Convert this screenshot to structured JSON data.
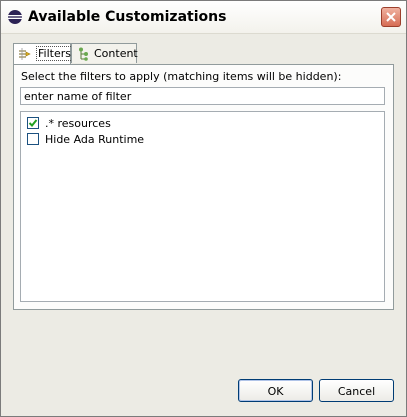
{
  "window": {
    "title": "Available Customizations"
  },
  "tabs": [
    {
      "label": "Filters",
      "icon": "filter-icon"
    },
    {
      "label": "Content",
      "icon": "content-tree-icon"
    }
  ],
  "filters": {
    "instruction": "Select the filters to apply (matching items will be hidden):",
    "input_value": "enter name of filter",
    "items": [
      {
        "label": ".* resources",
        "checked": true
      },
      {
        "label": "Hide Ada Runtime",
        "checked": false
      }
    ]
  },
  "buttons": {
    "ok": "OK",
    "cancel": "Cancel"
  },
  "colors": {
    "check": "#21a121",
    "close_button": "#d66d55",
    "accent": "#003c74"
  }
}
